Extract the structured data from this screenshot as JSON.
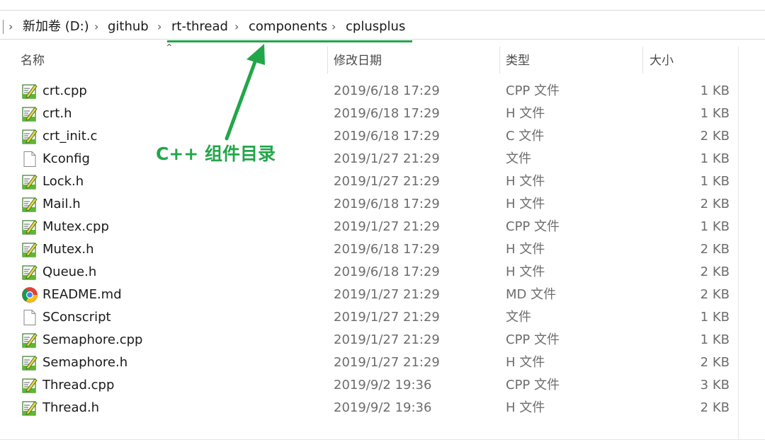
{
  "breadcrumb": {
    "items": [
      "新加卷 (D:)",
      "github",
      "rt-thread",
      "components",
      "cplusplus"
    ]
  },
  "columns": {
    "name": "名称",
    "date": "修改日期",
    "type": "类型",
    "size": "大小"
  },
  "files": [
    {
      "name": "crt.cpp",
      "date": "2019/6/18 17:29",
      "type": "CPP 文件",
      "size": "1 KB",
      "icon": "source-file-icon"
    },
    {
      "name": "crt.h",
      "date": "2019/6/18 17:29",
      "type": "H 文件",
      "size": "1 KB",
      "icon": "source-file-icon"
    },
    {
      "name": "crt_init.c",
      "date": "2019/6/18 17:29",
      "type": "C 文件",
      "size": "2 KB",
      "icon": "source-file-icon"
    },
    {
      "name": "Kconfig",
      "date": "2019/1/27 21:29",
      "type": "文件",
      "size": "1 KB",
      "icon": "blank-file-icon"
    },
    {
      "name": "Lock.h",
      "date": "2019/1/27 21:29",
      "type": "H 文件",
      "size": "1 KB",
      "icon": "source-file-icon"
    },
    {
      "name": "Mail.h",
      "date": "2019/6/18 17:29",
      "type": "H 文件",
      "size": "2 KB",
      "icon": "source-file-icon"
    },
    {
      "name": "Mutex.cpp",
      "date": "2019/1/27 21:29",
      "type": "CPP 文件",
      "size": "1 KB",
      "icon": "source-file-icon"
    },
    {
      "name": "Mutex.h",
      "date": "2019/6/18 17:29",
      "type": "H 文件",
      "size": "2 KB",
      "icon": "source-file-icon"
    },
    {
      "name": "Queue.h",
      "date": "2019/6/18 17:29",
      "type": "H 文件",
      "size": "2 KB",
      "icon": "source-file-icon"
    },
    {
      "name": "README.md",
      "date": "2019/1/27 21:29",
      "type": "MD 文件",
      "size": "2 KB",
      "icon": "chrome-icon"
    },
    {
      "name": "SConscript",
      "date": "2019/1/27 21:29",
      "type": "文件",
      "size": "1 KB",
      "icon": "blank-file-icon"
    },
    {
      "name": "Semaphore.cpp",
      "date": "2019/1/27 21:29",
      "type": "CPP 文件",
      "size": "1 KB",
      "icon": "source-file-icon"
    },
    {
      "name": "Semaphore.h",
      "date": "2019/1/27 21:29",
      "type": "H 文件",
      "size": "2 KB",
      "icon": "source-file-icon"
    },
    {
      "name": "Thread.cpp",
      "date": "2019/9/2 19:36",
      "type": "CPP 文件",
      "size": "3 KB",
      "icon": "source-file-icon"
    },
    {
      "name": "Thread.h",
      "date": "2019/9/2 19:36",
      "type": "H 文件",
      "size": "2 KB",
      "icon": "source-file-icon"
    }
  ],
  "annotation": {
    "text": "C++ 组件目录",
    "color": "#22a64a"
  }
}
